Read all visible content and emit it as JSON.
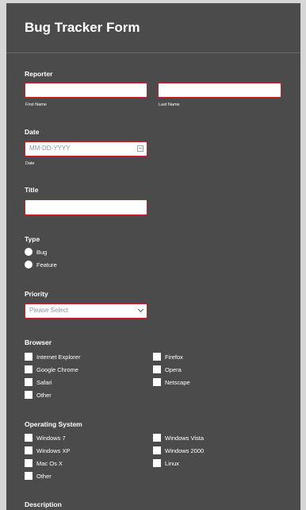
{
  "header": {
    "title": "Bug Tracker Form"
  },
  "reporter": {
    "label": "Reporter",
    "first_sublabel": "First Name",
    "last_sublabel": "Last Name"
  },
  "date": {
    "label": "Date",
    "placeholder": "MM-DD-YYYY",
    "sublabel": "Date"
  },
  "title_field": {
    "label": "Title"
  },
  "type": {
    "label": "Type",
    "options": [
      "Bug",
      "Feature"
    ]
  },
  "priority": {
    "label": "Priority",
    "selected": "Please Select"
  },
  "browser": {
    "label": "Browser",
    "options": [
      "Internet Explorer",
      "Google Chrome",
      "Safari",
      "Other",
      "Firefox",
      "Opera",
      "Netscape"
    ]
  },
  "os": {
    "label": "Operating System",
    "options": [
      "Windows 7",
      "Windows XP",
      "Mac Os X",
      "Other",
      "Windows Vista",
      "Windows 2000",
      "Linux"
    ]
  },
  "description": {
    "label": "Description"
  },
  "colors": {
    "card_bg": "#4b4b4b",
    "field_border": "#c8202b",
    "text": "#ffffff"
  }
}
